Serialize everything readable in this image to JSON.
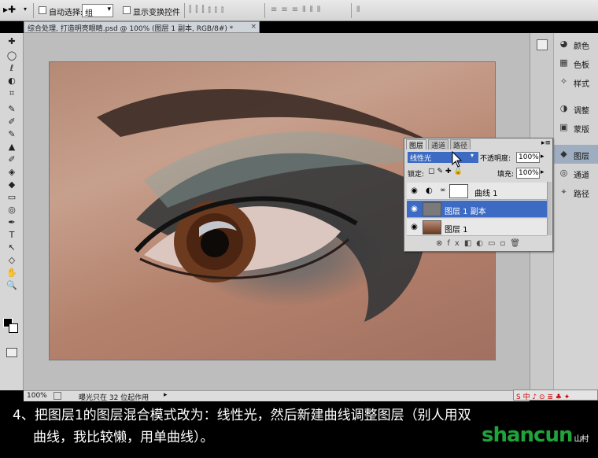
{
  "options_bar": {
    "auto_select_label": "自动选择:",
    "auto_select_value": "组",
    "show_transform_label": "显示变换控件"
  },
  "document": {
    "tab_title": "综合处理, 打造明亮眼睛.psd @ 100% (图层 1 副本, RGB/8#) *",
    "close_label": "×",
    "zoom": "100%",
    "status_text": "曝光只在 32 位起作用"
  },
  "tools": [
    "✚",
    "◯",
    "ℓ",
    "◐",
    "⌗",
    "✎",
    "✐",
    "✎",
    "▲",
    "✐",
    "◈",
    "◆",
    "▭",
    "◎",
    "✒",
    "T",
    "↖",
    "◇",
    "✋",
    "🔍"
  ],
  "dock": {
    "groups": [
      [
        {
          "icon": "palette-icon",
          "label": "颜色"
        },
        {
          "icon": "swatches-icon",
          "label": "色板"
        },
        {
          "icon": "styles-icon",
          "label": "样式"
        }
      ],
      [
        {
          "icon": "adjust-icon",
          "label": "调整"
        },
        {
          "icon": "mask-icon",
          "label": "蒙版"
        }
      ],
      [
        {
          "icon": "layers-icon",
          "label": "图层",
          "active": true
        },
        {
          "icon": "channels-icon",
          "label": "通道"
        },
        {
          "icon": "paths-icon",
          "label": "路径"
        }
      ]
    ]
  },
  "layers_panel": {
    "tabs": [
      "图层",
      "通道",
      "路径"
    ],
    "blend_mode": "线性光",
    "opacity_label": "不透明度:",
    "opacity_value": "100%",
    "lock_label": "锁定:",
    "fill_label": "填充:",
    "fill_value": "100%",
    "layers": [
      {
        "name": "曲线 1",
        "type": "curves"
      },
      {
        "name": "图层 1 副本",
        "type": "image",
        "selected": true
      },
      {
        "name": "图层 1",
        "type": "image"
      }
    ]
  },
  "caption": {
    "line1": "4、把图层1的图层混合模式改为：线性光，然后新建曲线调整图层（别人用双",
    "line2": "曲线，我比较懒，用单曲线）。"
  },
  "watermark": {
    "text": "shancun",
    "sub": "山村"
  },
  "tray": {
    "text": "S 中 ♪ ⊙ ≣ ♣ ✦"
  }
}
